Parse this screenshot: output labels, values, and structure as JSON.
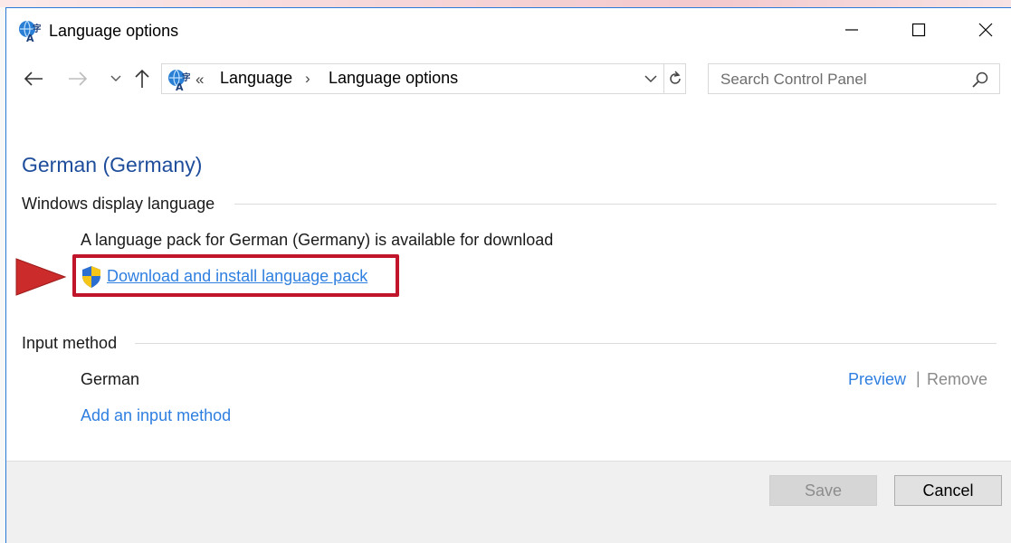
{
  "window": {
    "title": "Language options",
    "title_icon": "language-globe-icon"
  },
  "address_bar": {
    "overflow_chevrons": "«",
    "crumbs": [
      "Language",
      "Language options"
    ],
    "separator": "›"
  },
  "search": {
    "placeholder": "Search Control Panel"
  },
  "content": {
    "heading": "German (Germany)",
    "display_language": {
      "title": "Windows display language",
      "info": "A language pack for German (Germany) is available for download",
      "download_link": "Download and install language pack"
    },
    "input_method": {
      "title": "Input method",
      "language": "German",
      "preview_link": "Preview",
      "separator": "|",
      "remove_link": "Remove",
      "add_link": "Add an input method"
    }
  },
  "footer": {
    "save_label": "Save",
    "cancel_label": "Cancel"
  },
  "colors": {
    "heading": "#1e4d9b",
    "link": "#2f7fe0",
    "highlight": "#c0152a",
    "window_border": "#2b79d8"
  }
}
